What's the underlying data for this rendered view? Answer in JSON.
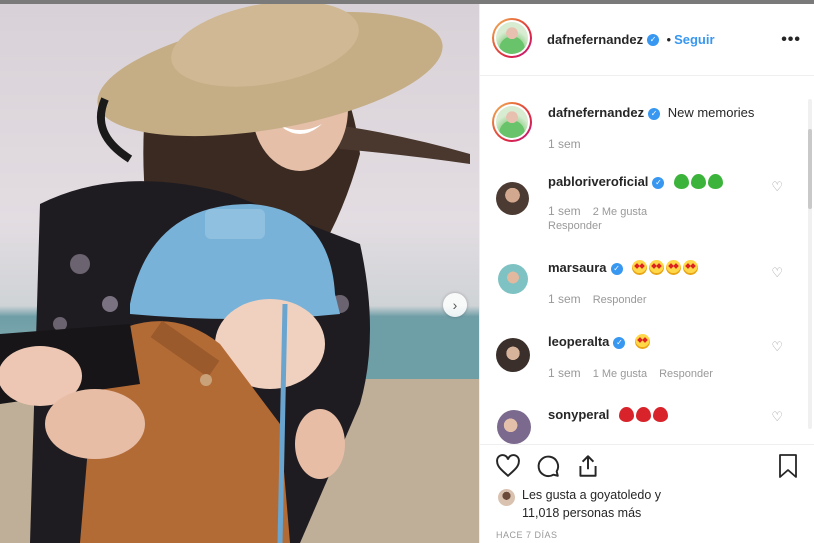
{
  "post": {
    "author": "dafnefernandez",
    "follow_label": "Seguir",
    "separator": "•",
    "more_label": "•••",
    "next_arrow": "›"
  },
  "caption": {
    "username": "dafnefernandez",
    "text": "New memories",
    "time": "1 sem"
  },
  "comments": [
    {
      "username": "pabloriveroficial",
      "emoji": [
        "green-heart",
        "green-heart",
        "green-heart"
      ],
      "time": "1 sem",
      "likes": "2 Me gusta",
      "reply": "Responder"
    },
    {
      "username": "marsaura",
      "emoji": [
        "star-eyes",
        "star-eyes",
        "star-eyes",
        "star-eyes"
      ],
      "time": "1 sem",
      "likes": "",
      "reply": "Responder"
    },
    {
      "username": "leoperalta",
      "emoji": [
        "star-eyes"
      ],
      "time": "1 sem",
      "likes": "1 Me gusta",
      "reply": "Responder"
    },
    {
      "username": "sonyperal",
      "emoji": [
        "red-heart",
        "red-heart",
        "red-heart"
      ],
      "time": "",
      "likes": "",
      "reply": ""
    }
  ],
  "actions": {
    "icons": [
      "heart-icon",
      "comment-icon",
      "share-icon",
      "bookmark-icon"
    ],
    "likes_line1": "Les gusta a goyatoledo y",
    "likes_line2": "11,018 personas más",
    "posted_ago": "HACE 7 DÍAS"
  },
  "colors": {
    "link_blue": "#3897f0",
    "text": "#262626",
    "muted": "#999999"
  }
}
